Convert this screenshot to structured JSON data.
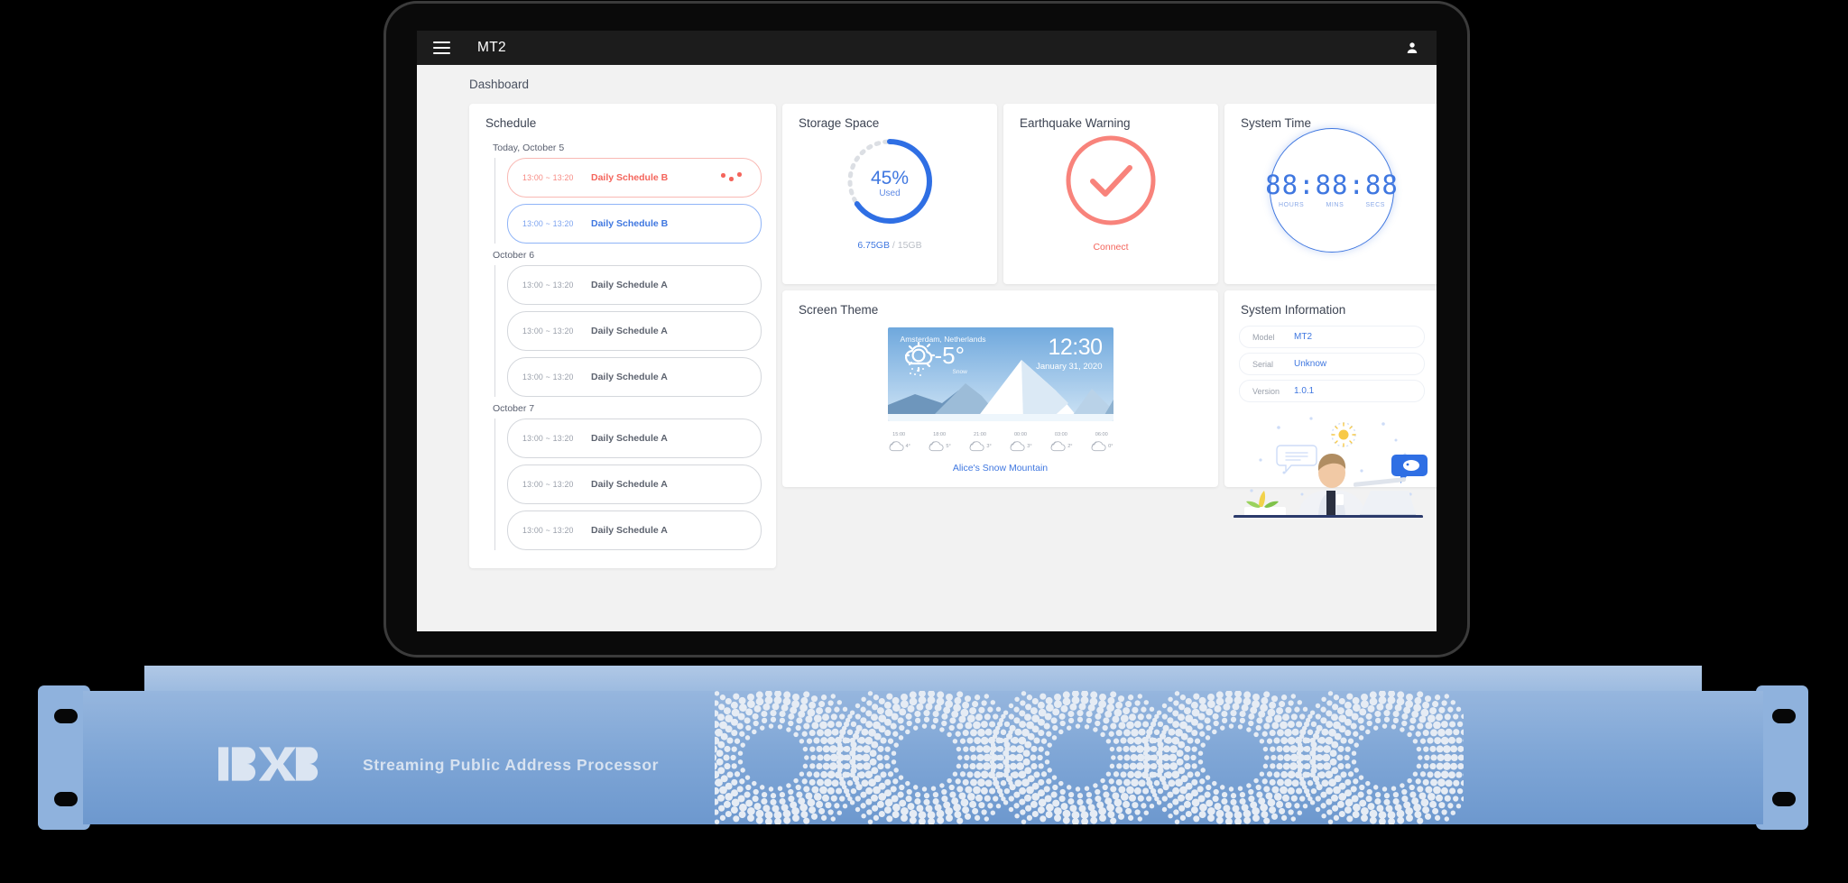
{
  "appbar": {
    "menu_icon": "hamburger-icon",
    "title": "MT2",
    "user_icon": "user-account-icon"
  },
  "breadcrumb": "Dashboard",
  "schedule": {
    "title": "Schedule",
    "days": [
      {
        "label": "Today, October 5",
        "events": [
          {
            "time": "13:00 ~ 13:20",
            "name": "Daily Schedule B",
            "state": "red",
            "has_dots": true
          },
          {
            "time": "13:00 ~ 13:20",
            "name": "Daily Schedule B",
            "state": "blue",
            "has_dots": false
          }
        ]
      },
      {
        "label": "October 6",
        "events": [
          {
            "time": "13:00 ~ 13:20",
            "name": "Daily Schedule A",
            "state": "plain",
            "has_dots": false
          },
          {
            "time": "13:00 ~ 13:20",
            "name": "Daily Schedule A",
            "state": "plain",
            "has_dots": false
          },
          {
            "time": "13:00 ~ 13:20",
            "name": "Daily Schedule A",
            "state": "plain",
            "has_dots": false
          }
        ]
      },
      {
        "label": "October 7",
        "events": [
          {
            "time": "13:00 ~ 13:20",
            "name": "Daily Schedule A",
            "state": "plain",
            "has_dots": false
          },
          {
            "time": "13:00 ~ 13:20",
            "name": "Daily Schedule A",
            "state": "plain",
            "has_dots": false
          },
          {
            "time": "13:00 ~ 13:20",
            "name": "Daily Schedule A",
            "state": "plain",
            "has_dots": false
          }
        ]
      }
    ]
  },
  "storage": {
    "title": "Storage Space",
    "percent": "45%",
    "percent_value": 45,
    "used_label": "Used",
    "used": "6.75GB",
    "separator": "/",
    "total": "15GB",
    "arc_color": "#2f6fe4",
    "track_color": "#dcdfe4"
  },
  "earthquake": {
    "title": "Earthquake Warning",
    "status_icon": "check-circle-icon",
    "action": "Connect",
    "color": "#f8837b"
  },
  "system_time": {
    "title": "System Time",
    "display": "88:88:88",
    "units": [
      "HOURS",
      "MINS",
      "SECS"
    ],
    "color": "#3f77e0"
  },
  "screen_theme": {
    "title": "Screen Theme",
    "name": "Alice's Snow Mountain",
    "preview": {
      "city": "Amsterdam, Netherlands",
      "temperature": "-5°",
      "condition": "Snow",
      "weather_icon": "sun-cloud-snow-icon",
      "time": "12:30",
      "date": "January 31, 2020"
    },
    "hourly": [
      {
        "hour": "15:00",
        "temp": "4°",
        "icon": "cloud-icon"
      },
      {
        "hour": "18:00",
        "temp": "5°",
        "icon": "cloud-icon"
      },
      {
        "hour": "21:00",
        "temp": "3°",
        "icon": "cloud-icon"
      },
      {
        "hour": "00:00",
        "temp": "3°",
        "icon": "cloud-icon"
      },
      {
        "hour": "03:00",
        "temp": "2°",
        "icon": "cloud-icon"
      },
      {
        "hour": "06:00",
        "temp": "0°",
        "icon": "cloud-icon"
      }
    ]
  },
  "system_information": {
    "title": "System Information",
    "rows": [
      {
        "key": "Model",
        "value": "MT2"
      },
      {
        "key": "Serial",
        "value": "Unknow"
      },
      {
        "key": "Version",
        "value": "1.0.1"
      }
    ],
    "illustration": "person-at-laptop-illustration"
  },
  "hardware": {
    "brand": "BXB",
    "subtitle": "Streaming Public Address Processor",
    "panel_color": "#7fa6d6",
    "dot_color": "#e6ecf4"
  }
}
